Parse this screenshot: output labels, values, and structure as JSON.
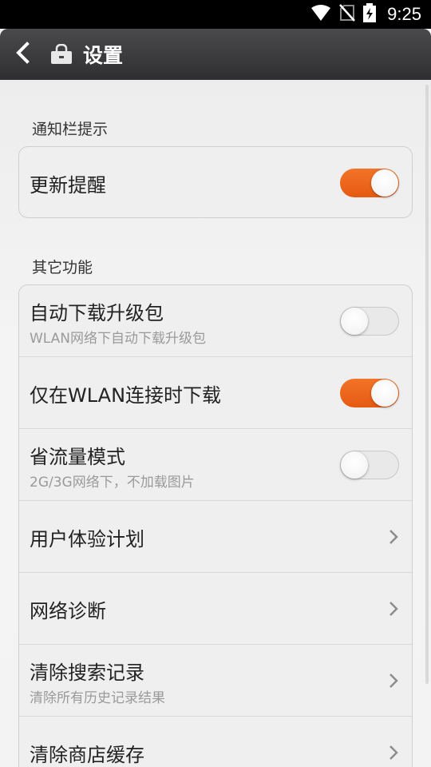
{
  "status_bar": {
    "time": "9:25"
  },
  "action_bar": {
    "title": "设置"
  },
  "sections": {
    "notification": {
      "header": "通知栏提示",
      "update_reminder": {
        "title": "更新提醒",
        "enabled": true
      }
    },
    "other": {
      "header": "其它功能",
      "auto_download": {
        "title": "自动下载升级包",
        "subtitle": "WLAN网络下自动下载升级包",
        "enabled": false
      },
      "wlan_only": {
        "title": "仅在WLAN连接时下载",
        "enabled": true
      },
      "data_saver": {
        "title": "省流量模式",
        "subtitle": "2G/3G网络下，不加载图片",
        "enabled": false
      },
      "user_experience": {
        "title": "用户体验计划"
      },
      "network_diagnosis": {
        "title": "网络诊断"
      },
      "clear_search": {
        "title": "清除搜索记录",
        "subtitle": "清除所有历史记录结果"
      },
      "clear_cache": {
        "title": "清除商店缓存"
      }
    }
  },
  "colors": {
    "toggle_on": "#f06a1e",
    "action_bar": "#3c3c3e"
  },
  "icons": [
    "wifi-icon",
    "no-sim-icon",
    "battery-charging-icon",
    "back-arrow-icon",
    "store-bag-icon",
    "chevron-right-icon"
  ]
}
